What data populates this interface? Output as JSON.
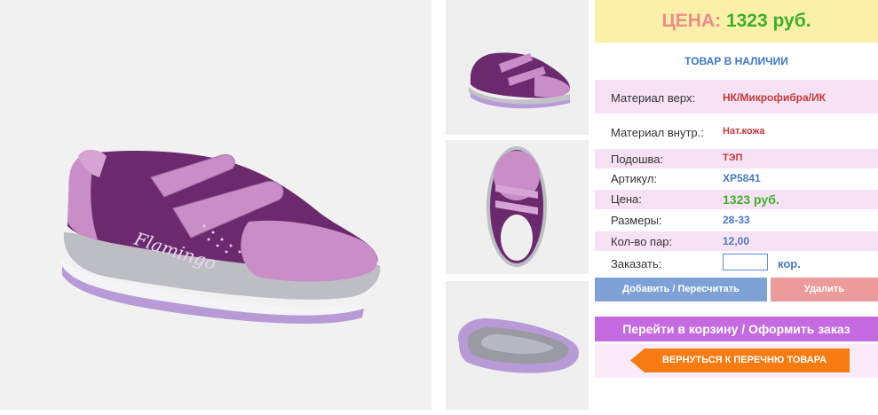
{
  "price": {
    "label": "ЦЕНА:",
    "value": "1323 руб."
  },
  "stock_status": "ТОВАР В НАЛИЧИИ",
  "specs": {
    "material_top": {
      "label": "Материал верх:",
      "value": "НК/Микрофибра/ИК"
    },
    "material_inner": {
      "label": "Материал внутр.:",
      "value": "Нат.кожа"
    },
    "sole": {
      "label": "Подошва:",
      "value": "ТЭП"
    },
    "article": {
      "label": "Артикул:",
      "value": "XP5841"
    },
    "price": {
      "label": "Цена:",
      "value": "1323 руб."
    },
    "sizes": {
      "label": "Размеры:",
      "value": "28-33"
    },
    "pairs": {
      "label": "Кол-во пар:",
      "value": "12,00"
    }
  },
  "order": {
    "label": "Заказать:",
    "value": "",
    "unit": "кор."
  },
  "buttons": {
    "add": "Добавить / Пересчитать",
    "delete": "Удалить",
    "cart": "Перейти в корзину / Оформить заказ",
    "back": "ВЕРНУТЬСЯ К ПЕРЕЧНЮ ТОВАРА"
  },
  "brand_on_shoe": "Flamingo",
  "colors": {
    "price_bg": "#faf0a8",
    "price_label": "#ee8a8a",
    "price_value": "#3fae2a",
    "row_pink": "#f7e1f4",
    "btn_add": "#7fa2d6",
    "btn_delete": "#ec9b9b",
    "btn_cart": "#c56ae0",
    "btn_back": "#f77b12",
    "shoe_purple": "#6b2a6e",
    "shoe_lilac": "#c98ec8"
  }
}
